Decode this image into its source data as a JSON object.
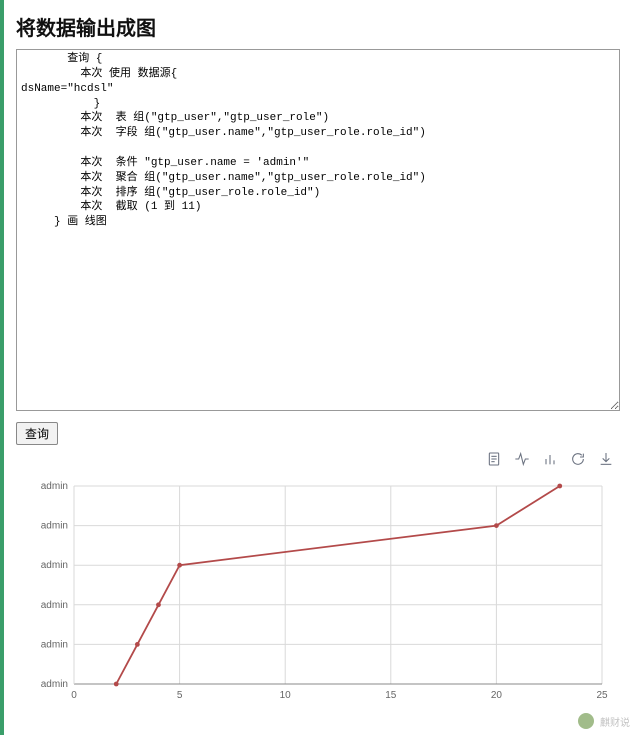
{
  "accent_color": "#3a9e6a",
  "title": "将数据输出成图",
  "code": "       查询 {\n         本次 使用 数据源{\ndsName=\"hcdsl\"\n           }\n         本次  表 组(\"gtp_user\",\"gtp_user_role\")\n         本次  字段 组(\"gtp_user.name\",\"gtp_user_role.role_id\")\n\n         本次  条件 \"gtp_user.name = 'admin'\"\n         本次  聚合 组(\"gtp_user.name\",\"gtp_user_role.role_id\")\n         本次  排序 组(\"gtp_user_role.role_id\")\n         本次  截取 (1 到 11)\n     } 画 线图",
  "query_label": "查询",
  "toolbar_icons": [
    "document-icon",
    "activity-icon",
    "barchart-icon",
    "refresh-icon",
    "download-icon"
  ],
  "chart_data": {
    "type": "line",
    "xlabel": "",
    "ylabel": "",
    "x_ticks": [
      0,
      5,
      10,
      15,
      20,
      25
    ],
    "y_tick_labels": [
      "admin",
      "admin",
      "admin",
      "admin",
      "admin",
      "admin"
    ],
    "xlim": [
      0,
      25
    ],
    "ylim": [
      0,
      5
    ],
    "series": [
      {
        "name": "admin",
        "points": [
          {
            "x": 2,
            "y": 0
          },
          {
            "x": 3,
            "y": 1
          },
          {
            "x": 4,
            "y": 2
          },
          {
            "x": 5,
            "y": 3
          },
          {
            "x": 20,
            "y": 4
          },
          {
            "x": 23,
            "y": 5
          }
        ]
      }
    ],
    "line_color": "#b34a4a"
  },
  "watermark": "麒财说"
}
